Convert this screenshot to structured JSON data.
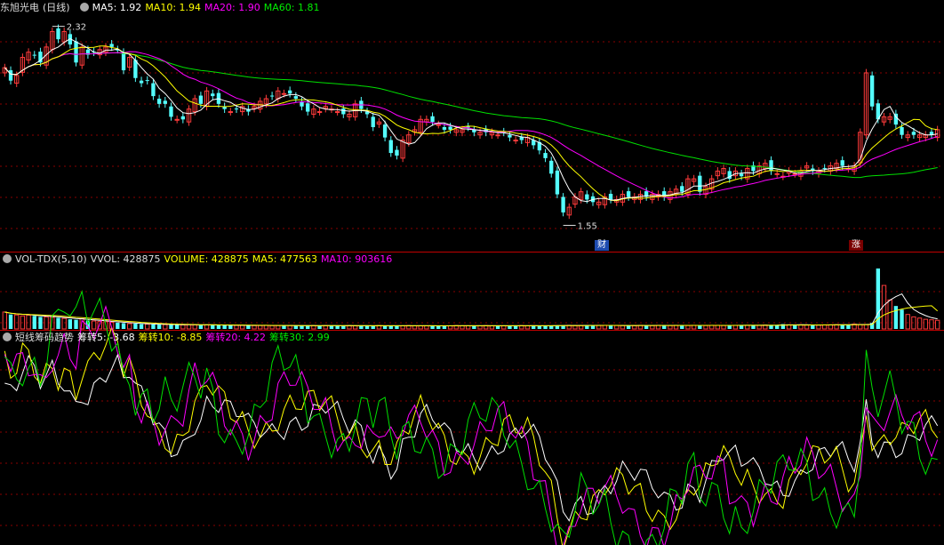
{
  "stock": {
    "name": "东旭光电",
    "period": "(日线)"
  },
  "price_header": {
    "ma5": "MA5: 1.92",
    "ma10": "MA10: 1.94",
    "ma20": "MA20: 1.90",
    "ma60": "MA60: 1.81"
  },
  "volume_header": {
    "indicator": "VOL-TDX(5,10)",
    "vvol": "VVOL: 428875",
    "volume": "VOLUME: 428875",
    "ma5": "MA5: 477563",
    "ma10": "MA10: 903616"
  },
  "chip_header": {
    "indicator": "短线筹码趋势",
    "c5": "筹转5: -3.68",
    "c10": "筹转10: -8.85",
    "c20": "筹转20: 4.22",
    "c30": "筹转30: 2.99"
  },
  "annotations": {
    "high": "2.32",
    "low": "1.55",
    "badge_cai": "财",
    "badge_zhang": "涨"
  },
  "colors": {
    "up": "#ff3b3b",
    "down": "#54ffff",
    "ma5": "#ffffff",
    "ma10": "#ffff00",
    "ma20": "#ff00ff",
    "ma60": "#00e000",
    "grid": "#8a0000"
  },
  "chart_data": [
    {
      "type": "candlestick",
      "title": "东旭光电 (日线)",
      "y_range": [
        1.5,
        2.36
      ],
      "close": [
        2.16,
        2.11,
        2.13,
        2.2,
        2.22,
        2.21,
        2.18,
        2.24,
        2.3,
        2.27,
        2.3,
        2.25,
        2.18,
        2.24,
        2.21,
        2.22,
        2.23,
        2.24,
        2.24,
        2.23,
        2.15,
        2.2,
        2.12,
        2.1,
        2.11,
        2.05,
        2.02,
        2.02,
        1.97,
        1.96,
        1.96,
        2.0,
        2.04,
        2.02,
        2.07,
        2.05,
        2.02,
        2.0,
        1.99,
        2.0,
        2.01,
        1.99,
        2.01,
        2.03,
        2.04,
        2.05,
        2.07,
        2.06,
        2.06,
        2.04,
        2.01,
        1.99,
        2.0,
        1.99,
        2.01,
        2.0,
        1.99,
        1.98,
        1.98,
        2.02,
        2.0,
        1.98,
        1.93,
        1.95,
        1.89,
        1.83,
        1.82,
        1.88,
        1.9,
        1.92,
        1.96,
        1.96,
        1.95,
        1.94,
        1.92,
        1.92,
        1.92,
        1.92,
        1.93,
        1.91,
        1.91,
        1.91,
        1.91,
        1.9,
        1.91,
        1.89,
        1.88,
        1.88,
        1.89,
        1.86,
        1.84,
        1.81,
        1.75,
        1.67,
        1.6,
        1.62,
        1.66,
        1.68,
        1.65,
        1.64,
        1.64,
        1.66,
        1.65,
        1.65,
        1.67,
        1.66,
        1.66,
        1.67,
        1.66,
        1.67,
        1.67,
        1.66,
        1.68,
        1.69,
        1.68,
        1.73,
        1.73,
        1.68,
        1.7,
        1.73,
        1.76,
        1.77,
        1.73,
        1.76,
        1.74,
        1.77,
        1.76,
        1.78,
        1.79,
        1.76,
        1.75,
        1.74,
        1.76,
        1.75,
        1.76,
        1.78,
        1.76,
        1.76,
        1.77,
        1.78,
        1.79,
        1.78,
        1.77,
        1.78,
        1.91,
        2.14,
        2.01,
        1.96,
        1.97,
        1.97,
        1.94,
        1.9,
        1.9,
        1.9,
        1.9,
        1.9,
        1.9,
        1.92
      ],
      "high": 2.32,
      "low": 1.55,
      "series": [
        {
          "name": "MA5",
          "values": [
            1.92
          ]
        },
        {
          "name": "MA10",
          "values": [
            1.94
          ]
        },
        {
          "name": "MA20",
          "values": [
            1.9
          ]
        },
        {
          "name": "MA60",
          "values": [
            1.81
          ]
        }
      ]
    },
    {
      "type": "bar",
      "title": "VOL-TDX(5,10)",
      "volume": [
        70,
        60,
        58,
        54,
        57,
        54,
        50,
        50,
        48,
        46,
        44,
        40,
        38,
        42,
        35,
        33,
        31,
        30,
        28,
        26,
        24,
        22,
        22,
        20,
        20,
        19,
        18,
        18,
        18,
        17,
        17,
        18,
        17,
        16,
        17,
        16,
        16,
        15,
        15,
        15,
        15,
        15,
        14,
        14,
        15,
        14,
        14,
        14,
        14,
        13,
        14,
        13,
        14,
        13,
        14,
        14,
        13,
        13,
        14,
        13,
        14,
        13,
        13,
        14,
        13,
        14,
        13,
        13,
        14,
        13,
        13,
        13,
        13,
        13,
        13,
        13,
        14,
        13,
        13,
        14,
        13,
        14,
        13,
        13,
        13,
        14,
        13,
        14,
        13,
        14,
        13,
        13,
        14,
        14,
        15,
        15,
        14,
        14,
        15,
        15,
        15,
        15,
        14,
        14,
        14,
        14,
        14,
        15,
        15,
        14,
        15,
        15,
        14,
        15,
        15,
        14,
        15,
        15,
        14,
        15,
        15,
        14,
        15,
        15,
        16,
        15,
        15,
        15,
        16,
        15,
        16,
        20,
        17,
        16,
        17,
        16,
        16,
        16,
        17,
        17,
        18,
        18,
        18,
        20,
        18,
        18,
        25,
        250,
        180,
        120,
        95,
        80,
        60,
        50,
        45,
        40,
        38,
        36
      ],
      "series": [
        {
          "name": "VOLUME",
          "values": [
            428875
          ]
        },
        {
          "name": "MA5",
          "values": [
            477563
          ]
        },
        {
          "name": "MA10",
          "values": [
            903616
          ]
        }
      ]
    },
    {
      "type": "line",
      "title": "短线筹码趋势",
      "series": [
        {
          "name": "筹转5",
          "values": [
            -3.68
          ]
        },
        {
          "name": "筹转10",
          "values": [
            -8.85
          ]
        },
        {
          "name": "筹转20",
          "values": [
            4.22
          ]
        },
        {
          "name": "筹转30",
          "values": [
            2.99
          ]
        }
      ]
    }
  ]
}
